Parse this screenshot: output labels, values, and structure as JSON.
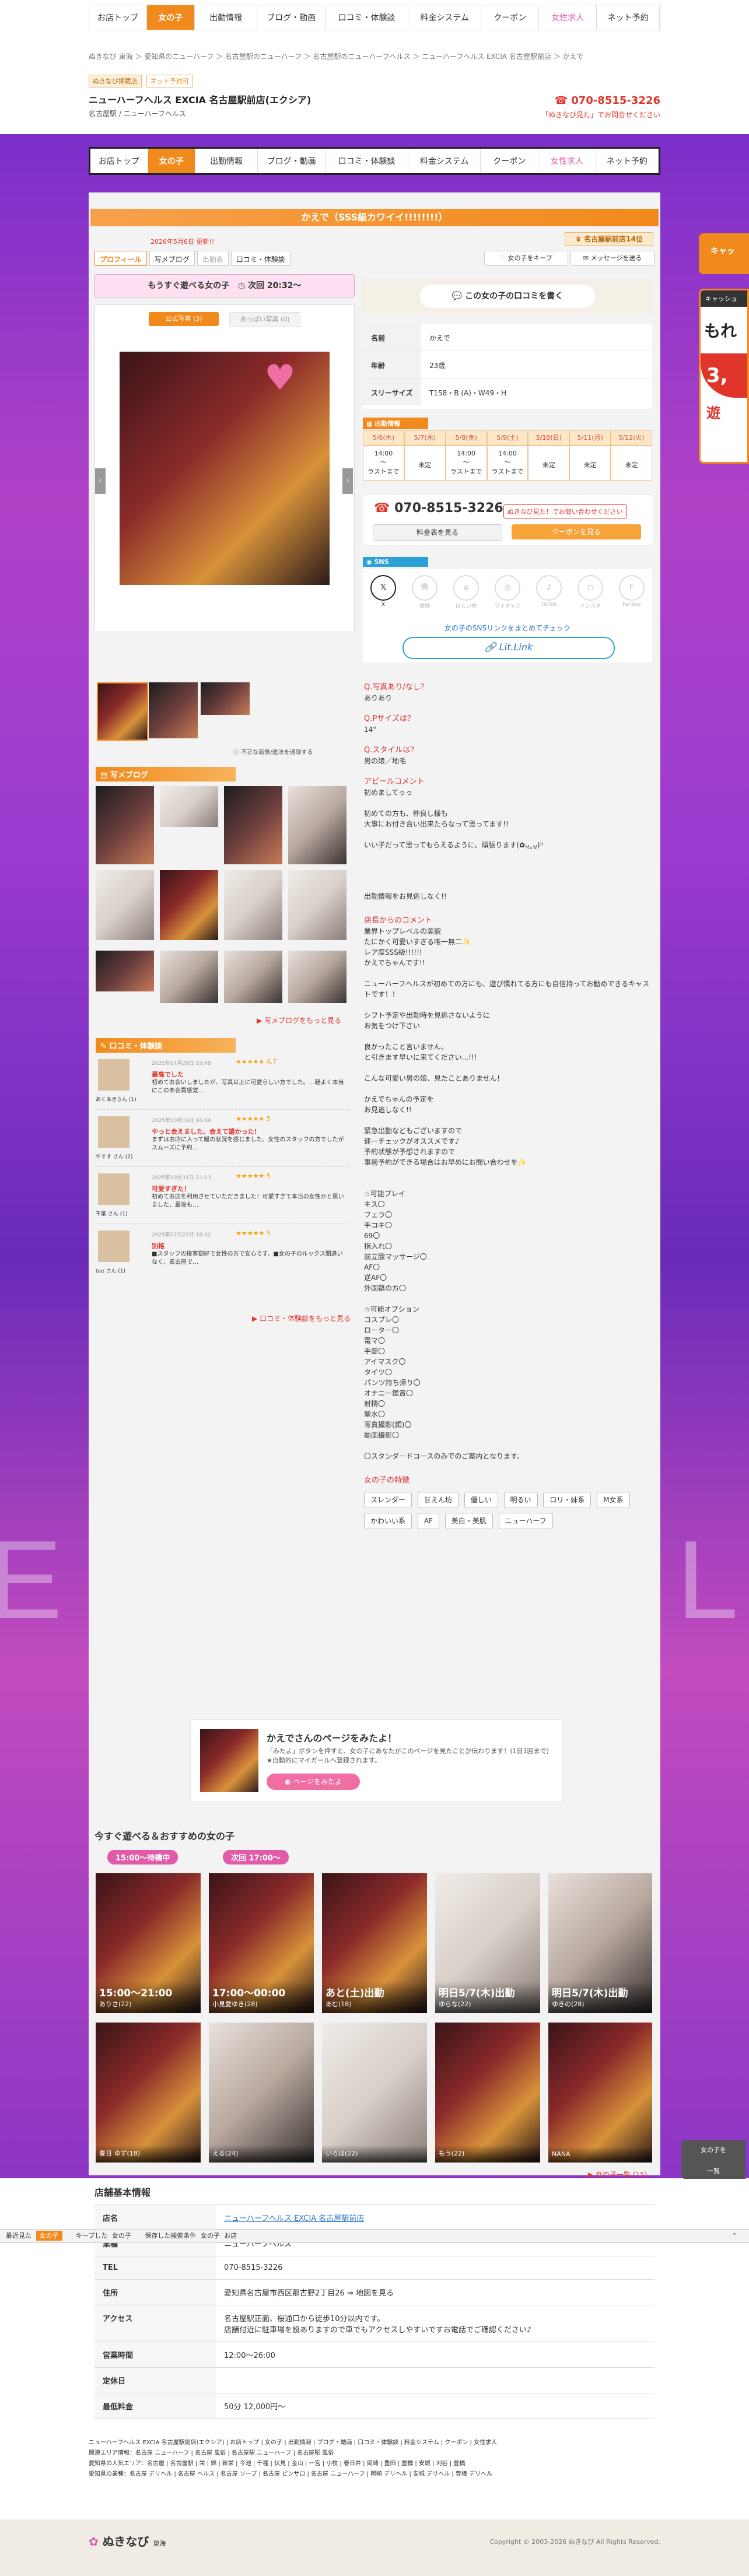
{
  "nav": {
    "items": [
      {
        "label": "お店トップ"
      },
      {
        "label": "女の子"
      },
      {
        "label": "出勤情報"
      },
      {
        "label": "ブログ・動画"
      },
      {
        "label": "口コミ・体験談"
      },
      {
        "label": "料金システム"
      },
      {
        "label": "クーポン"
      },
      {
        "label": "女性求人"
      },
      {
        "label": "ネット予約"
      }
    ]
  },
  "breadcrumb": "ぬきなび 東海 ＞ 愛知県のニューハーフ ＞ 名古屋駅のニューハーフ ＞ 名古屋駅のニューハーフヘルス ＞ ニューハーフヘルス EXCIA 名古屋駅前店 ＞ かえで",
  "shop": {
    "badge1": "ぬきなび掲載店",
    "badge2": "ネット予約可",
    "name": "ニューハーフヘルス EXCIA 名古屋駅前店(エクシア)",
    "area": "名古屋駅 / ニューハーフヘルス",
    "phone": "070-8515-3226",
    "phone_note": "「ぬきなび見た」でお問合せください",
    "phone_note_strong": "「ぬきなび見た」"
  },
  "profile": {
    "title": "かえで（SSS級カワイイ!!!!!!!!）",
    "updated": "2026年5月6日 更新!!",
    "rank_badge": "名古屋駅前店14位",
    "tabs": [
      "プロフィール",
      "写メブログ",
      "出勤表",
      "口コミ・体験談"
    ],
    "fav_button": "女の子をキープ",
    "msg_button": "メッセージを送る",
    "available_banner": "もうすぐ遊べる女の子",
    "next_time": "次回 20:32〜",
    "photo_tabs": [
      "公式写真 (3)",
      "あっぱい写真 (0)"
    ],
    "photo_note": "不正な画像/違法を通報する",
    "review_button": "この女の子の口コミを書く",
    "fields": [
      {
        "label": "名前",
        "value": "かえで"
      },
      {
        "label": "年齢",
        "value": "23歳"
      },
      {
        "label": "スリーサイズ",
        "value": "T158・B (A)・W49・H"
      }
    ],
    "schedule_title": "出勤情報",
    "schedule": [
      {
        "date": "5/6(木)",
        "time": "14:00\n〜\nラストまで"
      },
      {
        "date": "5/7(木)",
        "time": "未定"
      },
      {
        "date": "5/8(金)",
        "time": "14:00\n〜\nラストまで"
      },
      {
        "date": "5/9(土)",
        "time": "14:00\n〜\nラストまで"
      },
      {
        "date": "5/10(日)",
        "time": "未定"
      },
      {
        "date": "5/11(月)",
        "time": "未定"
      },
      {
        "date": "5/12(火)",
        "time": "未定"
      }
    ],
    "tel_label": "070-8515-3226",
    "tel_note": "ぬきなび見た！でお問い合わせください",
    "price_button": "料金表を見る",
    "coupon_button": "クーポンを見る",
    "sns_title": "SNS",
    "sns": [
      {
        "name": "X"
      },
      {
        "name": "微博"
      },
      {
        "name": "ほしい物"
      },
      {
        "name": "ツイキャス"
      },
      {
        "name": "TikTok"
      },
      {
        "name": "インスタ"
      },
      {
        "name": "Fanbox"
      }
    ],
    "sns_link_text": "女の子のSNSリンクをまとめてチェック",
    "litlink": "Lit.Link"
  },
  "qa": [
    {
      "q": "Q.写真あり/なし？",
      "a": "ありあり"
    },
    {
      "q": "Q.Pサイズは？",
      "a": "14°"
    },
    {
      "q": "Q.スタイルは？",
      "a": "男の娘／地毛"
    }
  ],
  "appeal": {
    "title": "アピールコメント",
    "p1": "初めましてっっ",
    "p2": "初めての方も、仲良し様も\n大事にお付き合い出来たらなって思ってます!!",
    "p3": "いい子だって思ってもらえるように、頑張ります(✿ᴗ͈ˬᴗ͈)⁾⁾",
    "p4": "出勤情報をお見逃しなく!!"
  },
  "shop_comment": {
    "title": "店長からのコメント",
    "p1": "業界トップレベルの美貌\nたにかく可愛いすぎる唯一無二✨\nレア度SSS級!!!!!!\nかえでちゃんです!!",
    "p2": "ニューハーフヘルスが初めての方にも、遊び慣れてる方にも自信持ってお勧めできるキャストです！！",
    "p3": "シフト予定や出勤時を見逃さないように\nお気をつけ下さい",
    "p4": "良かったこと言いません、\nと引きます早いに来てください...!!!",
    "p5": "こんな可愛い男の娘、見たことありません！",
    "p6": "かえでちゃんの予定を\nお見逃しなく!!",
    "p7": "緊急出勤などもございますので\n速ーチェックがオススメです♪\n予約状態が予想されますので\n事前予約ができる場合はお早めにお問い合わせを✨",
    "play_list": "☆可能プレイ\nキス〇\nフェラ〇\n手コキ〇\n69〇\n指入れ〇\n前立腺マッサージ〇\nAF〇\n逆AF〇\n外国籍の方〇",
    "opt_list": "☆可能オプション\nコスプレ〇\nローター〇\n電マ〇\n手錠〇\nアイマスク〇\nタイツ〇\nパンツ持ち帰り〇\nオナニー鑑賞〇\n射精〇\n聖水〇\n写真撮影(顔)〇\n動画撮影〇",
    "standard": "〇スタンダードコースのみでのご案内となります。"
  },
  "traits": {
    "title": "女の子の特徴",
    "tags": [
      "スレンダー",
      "甘えん坊",
      "優しい",
      "明るい",
      "ロリ・妹系",
      "M女系",
      "かわいい系",
      "AF",
      "美白・美肌",
      "ニューハーフ"
    ]
  },
  "blog": {
    "title": "写メブログ",
    "more": "写メブログをもっと見る"
  },
  "reviews": {
    "title": "口コミ・体験談",
    "more": "口コミ・体験談をもっと見る",
    "items": [
      {
        "name": "あくあきさん (1)",
        "date": "2025年04月29日 15:48",
        "stars": "★★★★★ 4.7",
        "title": "最高でした",
        "body": "初めてお会いしましたが、写真以上に可愛らしい方でした。…軽よく本当にこのあ会貢感覚…"
      },
      {
        "name": "やすす さん (2)",
        "date": "2025年10月19日 16:44",
        "stars": "★★★★★ 5",
        "title": "やっと会えました、会えて嬉かった！",
        "body": "まずはお店に入って暖の状況を感じました。女性のスタッフの方でしたがスムーズに予約…"
      },
      {
        "name": "千葉 さん (1)",
        "date": "2025年10月31日 21:13",
        "stars": "★★★★★ 5",
        "title": "可愛すぎた！",
        "body": "初めてお店を利用させていただきました！可愛すぎて本当の女性かと思いました、最後も…"
      },
      {
        "name": "tee さん (1)",
        "date": "2025年07月22日 16:32",
        "stars": "★★★★★ 5",
        "title": "別格",
        "body": "■スタッフの接客御好で女性の方で安心です。■女の子のルックス間違いなく、名古屋で…"
      }
    ]
  },
  "promo": {
    "title": "かえでさんのページをみたよ！",
    "body": "「みたよ」ボタンを押すと、女の子にあなたがこのページを見たことが伝わります！(1日1回まで) ★自動的にマイガールへ登録されます。",
    "button": "ページをみたよ"
  },
  "recommend": {
    "title": "今すぐ遊べる＆おすすめの女の子",
    "pill1": "15:00〜待機中",
    "pill2": "次回 17:00〜",
    "row1": [
      {
        "time": "15:00〜21:00",
        "name": "ありさ(22)"
      },
      {
        "time": "17:00〜00:00",
        "name": "小見愛ゆき(28)"
      },
      {
        "time": "あと(土)出勤",
        "name": "あむ(18)"
      },
      {
        "time": "明日5/7(木)出勤",
        "name": "ゆらな(22)"
      },
      {
        "time": "明日5/7(木)出勤",
        "name": "ゆきの(28)"
      }
    ],
    "row2": [
      {
        "name": "春日 ゆず(18)"
      },
      {
        "name": "える(24)"
      },
      {
        "name": "いろは(22)"
      },
      {
        "name": "もう(22)"
      },
      {
        "name": "NANA"
      }
    ],
    "more": "女の子一覧 (15)"
  },
  "shop_info": {
    "title": "店舗基本情報",
    "rows": [
      {
        "h": "店名",
        "d": "ニューハーフヘルス EXCIA 名古屋駅前店"
      },
      {
        "h": "業種",
        "d": "ニューハーフヘルス"
      },
      {
        "h": "TEL",
        "d": "070-8515-3226"
      },
      {
        "h": "住所",
        "d": "愛知県名古屋市西区那古野2丁目26 ⇒ 地図を見る"
      },
      {
        "h": "アクセス",
        "d": "名古屋駅正面、桜通口から徒歩10分以内です。\n店舗付近に駐車場を設ありますので車でもアクセスしやすいですお電話でご確認ください♪"
      },
      {
        "h": "営業時間",
        "d": "12:00〜26:00"
      },
      {
        "h": "定休日",
        "d": ""
      },
      {
        "h": "最低料金",
        "d": "50分 12,000円〜"
      }
    ]
  },
  "history_bar": {
    "items": [
      "最近見た",
      "女の子",
      "キープした",
      "女の子",
      "保存した検索条件",
      "女の子",
      "お店"
    ]
  },
  "side_tabs": {
    "right1": "女の子を",
    "right2": "一覧",
    "top1": "キャッ",
    "top2": "キャッシュ",
    "top3": "もれ",
    "top4": "3,",
    "top5": "遊"
  },
  "footer": {
    "links1": "ニューハーフヘルス EXCIA 名古屋駅前店(エクシア) | お店トップ | 女の子 | 出勤情報 | ブログ・動画 | 口コミ・体験談 | 料金システム | クーポン | 女性求人",
    "links2": "関連エリア情報：名古屋 ニューハーフ | 名古屋 風俗 | 名古屋駅 ニューハーフ | 名古屋駅 風俗",
    "links3": "愛知県の人気エリア：名古屋 | 名古屋駅 | 栄 | 錦 | 新栄 | 今池 | 千種 | 伏見 | 金山 | 一宮 | 小牧 | 春日井 | 岡崎 | 豊田 | 豊橋 | 安城 | 刈谷 | 豊橋",
    "links4": "愛知県の業種：名古屋 デリヘル | 名古屋 ヘルス | 名古屋 ソープ | 名古屋 ピンサロ | 名古屋 ニューハーフ | 岡崎 デリヘル | 安城 デリヘル | 豊橋 デリヘル",
    "logo": "ぬきなび",
    "logo_sub": "東海",
    "copyright": "Copyright © 2003-2026 ぬきなび All Rights Reserved."
  },
  "colors": {
    "accent": "#f18a1c",
    "pink": "#e05ba8",
    "purple": "#7b2ec9"
  }
}
